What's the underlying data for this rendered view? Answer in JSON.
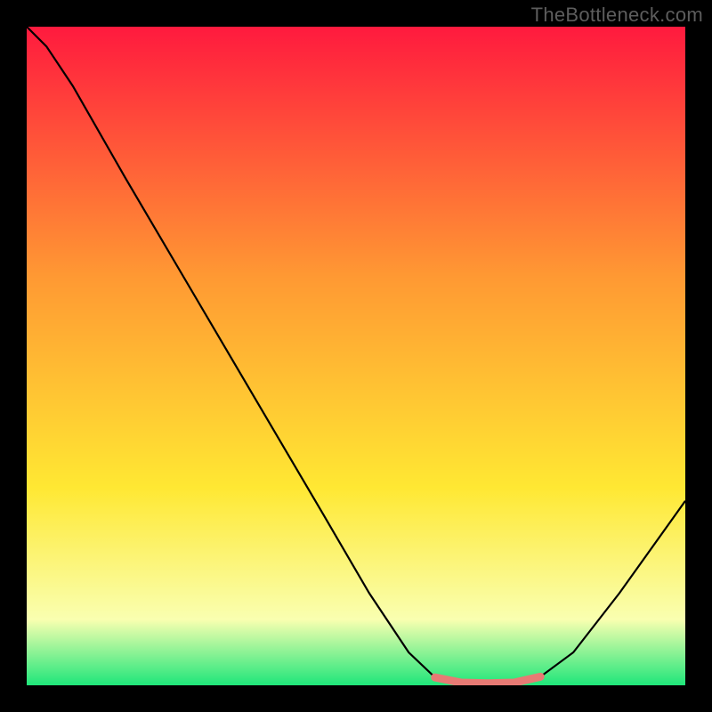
{
  "watermark": "TheBottleneck.com",
  "colors": {
    "frame": "#000000",
    "gradient_top": "#ff1a3e",
    "gradient_mid_orange": "#ff9933",
    "gradient_mid_yellow": "#ffe833",
    "gradient_low_yellow": "#f9ffb0",
    "gradient_bottom": "#1fe67a",
    "curve": "#000000",
    "highlight": "#e77a74"
  },
  "chart_data": {
    "type": "line",
    "xlabel": "",
    "ylabel": "",
    "xlim": [
      0,
      100
    ],
    "ylim": [
      0,
      100
    ],
    "curve": [
      {
        "x": 0,
        "y": 100
      },
      {
        "x": 3,
        "y": 97
      },
      {
        "x": 7,
        "y": 91
      },
      {
        "x": 15,
        "y": 77
      },
      {
        "x": 25,
        "y": 60
      },
      {
        "x": 35,
        "y": 43
      },
      {
        "x": 45,
        "y": 26
      },
      {
        "x": 52,
        "y": 14
      },
      {
        "x": 58,
        "y": 5
      },
      {
        "x": 62,
        "y": 1.2
      },
      {
        "x": 66,
        "y": 0.4
      },
      {
        "x": 70,
        "y": 0.3
      },
      {
        "x": 74,
        "y": 0.4
      },
      {
        "x": 78,
        "y": 1.3
      },
      {
        "x": 83,
        "y": 5
      },
      {
        "x": 90,
        "y": 14
      },
      {
        "x": 100,
        "y": 28
      }
    ],
    "highlight_segment": [
      {
        "x": 62,
        "y": 1.2
      },
      {
        "x": 66,
        "y": 0.4
      },
      {
        "x": 70,
        "y": 0.3
      },
      {
        "x": 74,
        "y": 0.4
      },
      {
        "x": 78,
        "y": 1.3
      }
    ]
  }
}
